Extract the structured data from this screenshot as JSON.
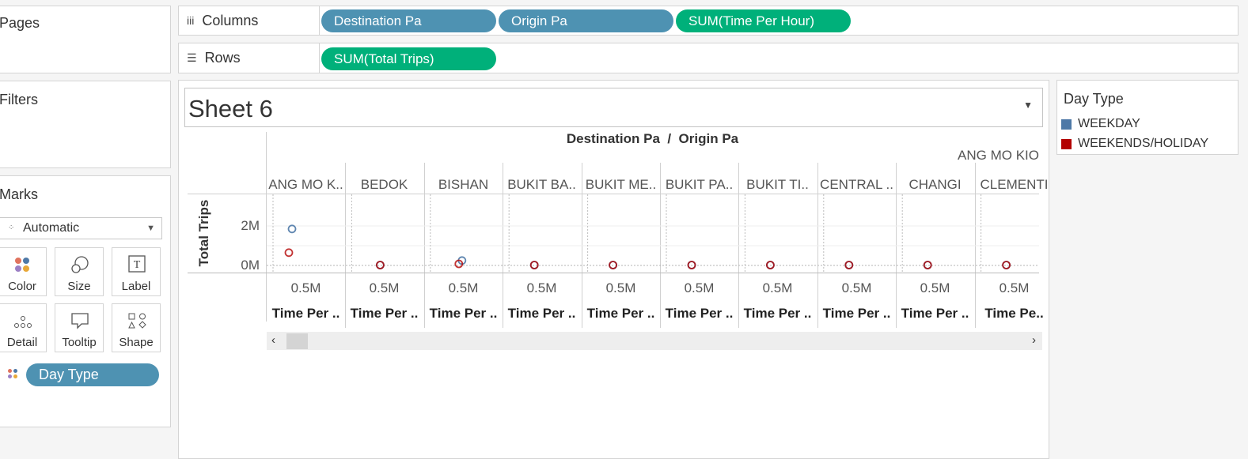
{
  "pages_panel": {
    "title": "Pages"
  },
  "filters_panel": {
    "title": "Filters"
  },
  "marks_panel": {
    "title": "Marks",
    "mark_type": "Automatic",
    "buttons": [
      {
        "label": "Color",
        "icon": "color-dots-icon"
      },
      {
        "label": "Size",
        "icon": "size-circles-icon"
      },
      {
        "label": "Label",
        "icon": "label-t-icon"
      },
      {
        "label": "Detail",
        "icon": "detail-dots-icon"
      },
      {
        "label": "Tooltip",
        "icon": "tooltip-bubble-icon"
      },
      {
        "label": "Shape",
        "icon": "shape-icon"
      }
    ],
    "color_field": "Day Type"
  },
  "columns_shelf": {
    "label": "Columns",
    "pills": [
      "Destination Pa",
      "Origin Pa",
      "SUM(Time Per Hour)"
    ]
  },
  "rows_shelf": {
    "label": "Rows",
    "pills": [
      "SUM(Total Trips)"
    ]
  },
  "sheet": {
    "title": "Sheet 6",
    "header_title": "Destination Pa  /  Origin Pa",
    "destination_label": "ANG MO KIO",
    "y_axis_title": "Total Trips",
    "y_ticks": [
      "2M",
      "0M"
    ],
    "x_tick": "0.5M",
    "x_axis_title": "Time Per ..",
    "last_x_axis_title": "Time Pe..",
    "panes": [
      "ANG MO K..",
      "BEDOK",
      "BISHAN",
      "BUKIT BA..",
      "BUKIT ME..",
      "BUKIT PA..",
      "BUKIT TI..",
      "CENTRAL ..",
      "CHANGI",
      "CLEMENTI"
    ]
  },
  "legend": {
    "title": "Day Type",
    "items": [
      {
        "label": "WEEKDAY",
        "color": "#4e79a7"
      },
      {
        "label": "WEEKENDS/HOLIDAY",
        "color": "#c00000"
      }
    ]
  },
  "chart_data": {
    "type": "scatter",
    "xlabel": "Time Per Hour",
    "ylabel": "Total Trips",
    "ylim": [
      -0.15,
      2.75
    ],
    "y_unit": "M",
    "x_tick_value": 0.5,
    "x_unit": "M",
    "series": [
      {
        "name": "WEEKDAY",
        "color": "#4e79a7",
        "points": [
          [
            0.4,
            1.85
          ],
          [
            0.55,
            0.02
          ],
          [
            0.6,
            0.25
          ],
          [
            0.5,
            0.02
          ],
          [
            0.5,
            0.02
          ],
          [
            0.5,
            0.02
          ],
          [
            0.5,
            0.02
          ],
          [
            0.5,
            0.02
          ],
          [
            0.5,
            0.02
          ],
          [
            0.5,
            0.02
          ]
        ]
      },
      {
        "name": "WEEKENDS/HOLIDAY",
        "color": "#c00000",
        "points": [
          [
            0.35,
            0.65
          ],
          [
            0.55,
            0.02
          ],
          [
            0.55,
            0.08
          ],
          [
            0.5,
            0.02
          ],
          [
            0.5,
            0.02
          ],
          [
            0.5,
            0.02
          ],
          [
            0.5,
            0.02
          ],
          [
            0.5,
            0.02
          ],
          [
            0.5,
            0.02
          ],
          [
            0.5,
            0.02
          ]
        ]
      }
    ]
  }
}
